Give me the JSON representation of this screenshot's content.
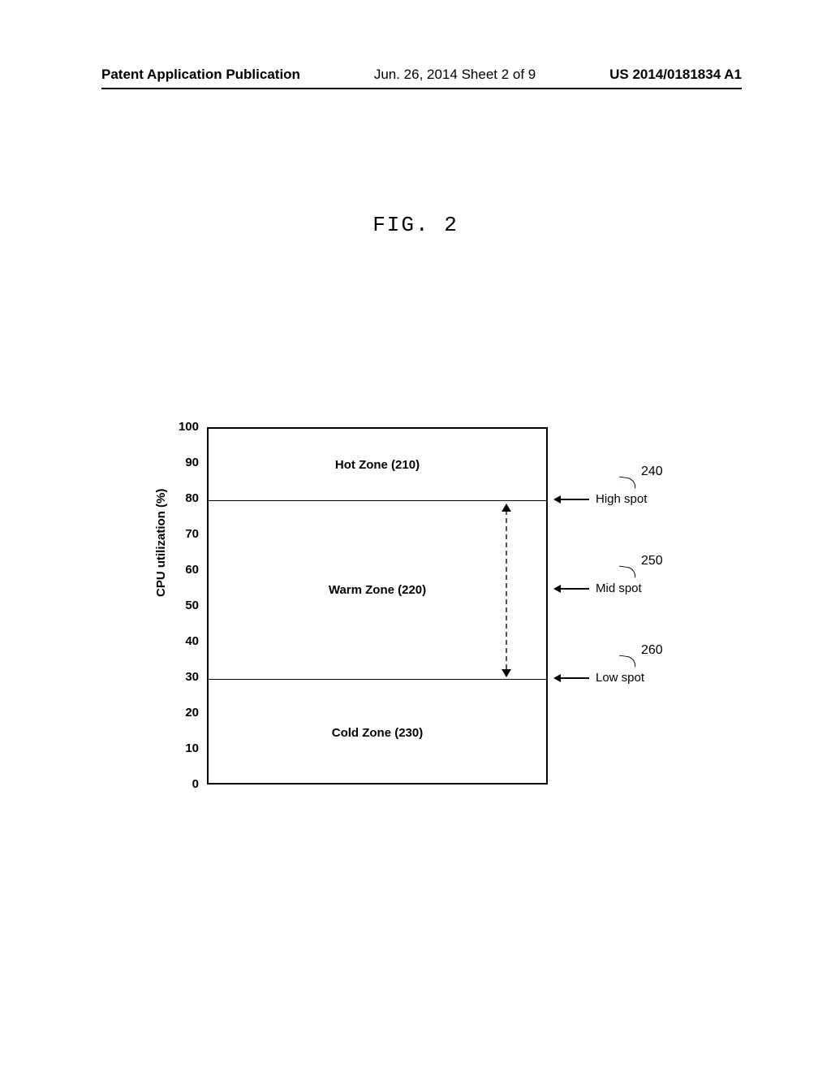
{
  "header": {
    "left": "Patent Application Publication",
    "mid": "Jun. 26, 2014  Sheet 2 of 9",
    "right": "US 2014/0181834 A1"
  },
  "figure_caption": "FIG. 2",
  "chart_data": {
    "type": "area",
    "ylabel": "CPU utilization (%)",
    "ylim": [
      0,
      100
    ],
    "yticks": [
      0,
      10,
      20,
      30,
      40,
      50,
      60,
      70,
      80,
      90,
      100
    ],
    "zones": [
      {
        "name": "Hot Zone (210)",
        "from": 80,
        "to": 100
      },
      {
        "name": "Warm Zone (220)",
        "from": 30,
        "to": 80
      },
      {
        "name": "Cold Zone (230)",
        "from": 0,
        "to": 30
      }
    ],
    "spots": [
      {
        "ref": "240",
        "label": "High spot",
        "at": 80
      },
      {
        "ref": "250",
        "label": "Mid spot",
        "at": 55
      },
      {
        "ref": "260",
        "label": "Low spot",
        "at": 30
      }
    ]
  }
}
